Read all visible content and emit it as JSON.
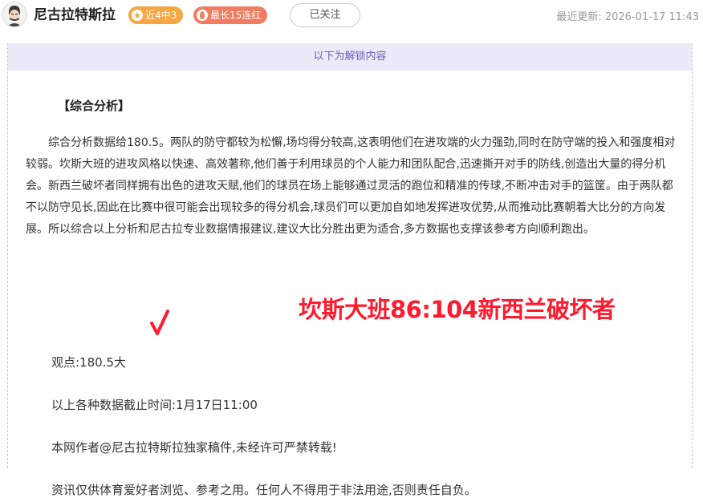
{
  "header": {
    "author": "尼古拉特斯拉",
    "badges": [
      {
        "label": "近4中3",
        "color": "#f5a742",
        "icon": "star-icon"
      },
      {
        "label": "最长15连红",
        "color": "#f07d61",
        "icon": "flame-icon"
      }
    ],
    "follow_label": "已关注",
    "last_update_label": "最近更新:",
    "last_update_value": "2026-01-17 11:43"
  },
  "unlock_banner": "以下为解锁内容",
  "article": {
    "section_title": "【综合分析】",
    "paragraph": "综合分析数据给180.5。两队的防守都较为松懈,场均得分较高,这表明他们在进攻端的火力强劲,同时在防守端的投入和强度相对较弱。坎斯大班的进攻风格以快速、高效著称,他们善于利用球员的个人能力和团队配合,迅速撕开对手的防线,创造出大量的得分机会。新西兰破坏者同样拥有出色的进攻天赋,他们的球员在场上能够通过灵活的跑位和精准的传球,不断冲击对手的篮筐。由于两队都不以防守见长,因此在比赛中很可能会出现较多的得分机会,球员们可以更加自如地发挥进攻优势,从而推动比赛朝着大比分的方向发展。所以综合以上分析和尼古拉专业数据情报建议,建议大比分胜出更为适合,多方数据也支撑该参考方向顺利跑出。",
    "viewpoint": "观点:180.5大",
    "data_time": "以上各种数据截止时间:1月17日11:00",
    "copyright": "本网作者@尼古拉特斯拉独家稿件,未经许可严禁转载!",
    "disclaimer": "资讯仅供体育爱好者浏览、参考之用。任何人不得用于非法用途,否则责任自负。"
  },
  "overlay": {
    "final_score": "坎斯大班86:104新西兰破坏者",
    "color": "#ff1a2e"
  }
}
